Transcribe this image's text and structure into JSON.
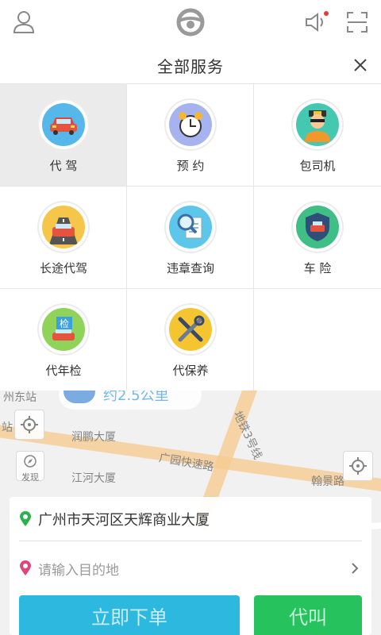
{
  "header": {
    "icons": {
      "user": "user-icon",
      "logo": "steering-wheel-logo",
      "speaker": "speaker-icon",
      "scan": "scan-icon"
    }
  },
  "services_panel": {
    "title": "全部服务",
    "close_icon": "close-icon",
    "items": [
      {
        "label": "代 驾",
        "icon": "car-icon",
        "selected": true
      },
      {
        "label": "预 约",
        "icon": "alarm-clock-icon",
        "selected": false
      },
      {
        "label": "包司机",
        "icon": "chauffeur-icon",
        "selected": false
      },
      {
        "label": "长途代驾",
        "icon": "road-car-icon",
        "selected": false
      },
      {
        "label": "违章查询",
        "icon": "magnifier-document-icon",
        "selected": false
      },
      {
        "label": "车 险",
        "icon": "shield-car-icon",
        "selected": false
      },
      {
        "label": "代年检",
        "icon": "inspection-car-icon",
        "selected": false
      },
      {
        "label": "代保养",
        "icon": "tools-icon",
        "selected": false
      }
    ]
  },
  "map": {
    "distance_text": "约2.5公里",
    "discover_label": "发现",
    "labels": [
      "润鹏大厦",
      "江河大厦",
      "广园快速路",
      "地铁3号线",
      "翰景路",
      "州东站",
      "站"
    ]
  },
  "trip": {
    "from_address": "广州市天河区天辉商业大厦",
    "to_placeholder": "请输入目的地"
  },
  "actions": {
    "order_now": "立即下单",
    "call_driver": "代叫"
  },
  "colors": {
    "order_button": "#2db8e0",
    "call_button": "#25c25e",
    "from_pin": "#2bb24c",
    "to_pin": "#e0457b",
    "notification_dot": "#e53935"
  }
}
